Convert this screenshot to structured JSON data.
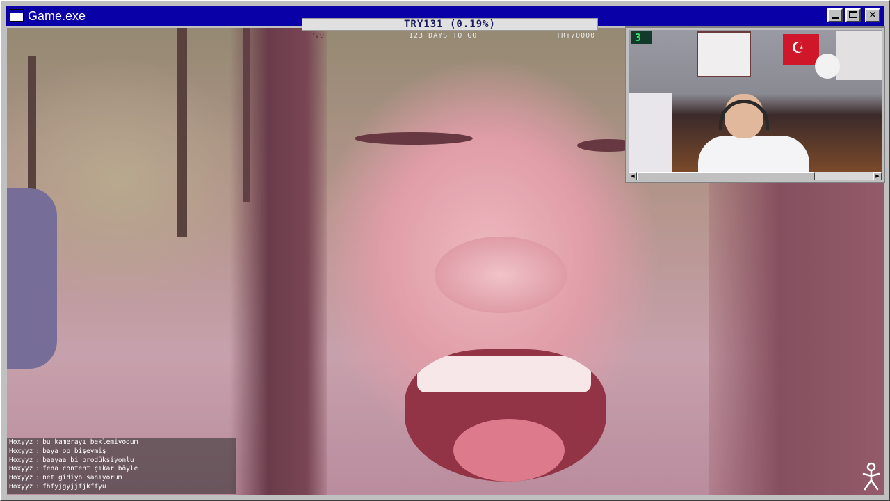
{
  "window": {
    "title": "Game.exe",
    "minimize_label": "",
    "maximize_label": "",
    "close_label": "✕"
  },
  "hud": {
    "top_value": "TRY131 (0.19%)",
    "left_value": "PVO",
    "days_left": "123 DAYS TO GO",
    "goal_value": "TRY70000"
  },
  "webcam": {
    "badge": "3",
    "scroll_left": "◀",
    "scroll_right": "▶"
  },
  "chat": {
    "messages": [
      {
        "user": "Hoxyyz",
        "text": "bu kamerayı beklemiyodum"
      },
      {
        "user": "Hoxyyz",
        "text": "baya op bişeymiş"
      },
      {
        "user": "Hoxyyz",
        "text": "baayaa bi prodüksiyonlu"
      },
      {
        "user": "Hoxyyz",
        "text": "fena content çıkar böyle"
      },
      {
        "user": "Hoxyyz",
        "text": "net gidiyo sanıyorum"
      },
      {
        "user": "Hoxyyz",
        "text": "fhfyjgyjjfjkffyu"
      }
    ]
  },
  "colors": {
    "titlebar": "#0a00a8",
    "chrome": "#c0c0c0",
    "badge_text": "#37e06a"
  },
  "icons": {
    "window_icon": "window-icon",
    "run_icon": "person-run-icon"
  }
}
